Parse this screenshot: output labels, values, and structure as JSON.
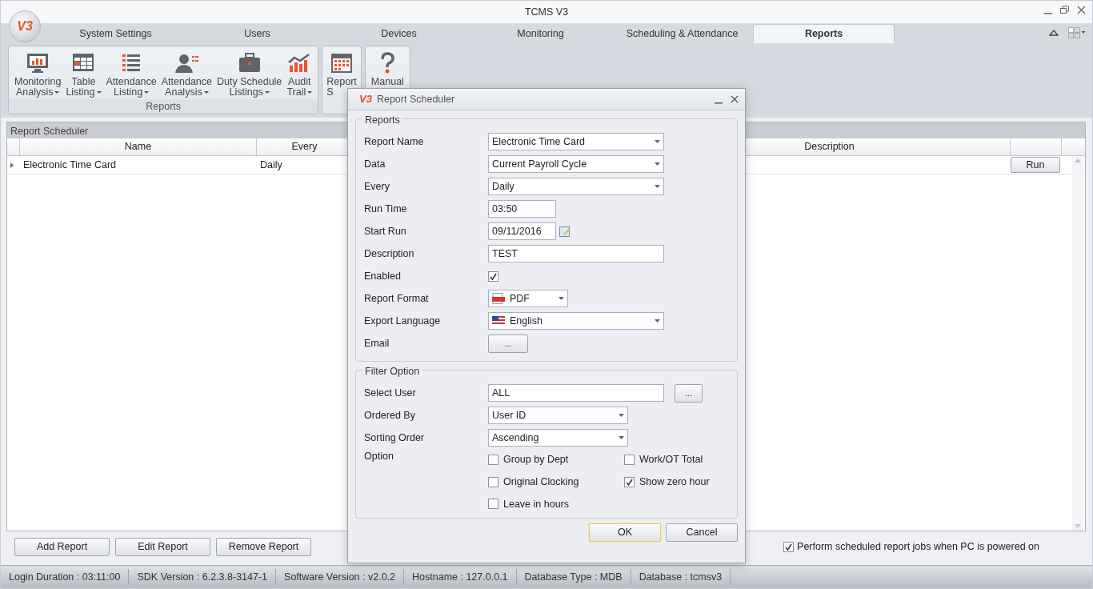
{
  "window": {
    "title": "TCMS V3",
    "logo": "V3"
  },
  "tabs": [
    {
      "label": "System Settings",
      "selected": false
    },
    {
      "label": "Users",
      "selected": false
    },
    {
      "label": "Devices",
      "selected": false
    },
    {
      "label": "Monitoring",
      "selected": false
    },
    {
      "label": "Scheduling & Attendance",
      "selected": false
    },
    {
      "label": "Reports",
      "selected": true
    }
  ],
  "ribbon": [
    {
      "label": "Reports",
      "buttons": [
        {
          "kind": "monitor",
          "lines": [
            "Monitoring",
            "Analysis"
          ],
          "dropdown": true
        },
        {
          "kind": "table",
          "lines": [
            "Table",
            "Listing"
          ],
          "dropdown": true
        },
        {
          "kind": "list",
          "lines": [
            "Attendance",
            "Listing"
          ],
          "dropdown": true
        },
        {
          "kind": "person",
          "lines": [
            "Attendance",
            "Analysis"
          ],
          "dropdown": true
        },
        {
          "kind": "briefcase",
          "lines": [
            "Duty Schedule",
            "Listings"
          ],
          "dropdown": true
        },
        {
          "kind": "trend",
          "lines": [
            "Audit",
            "Trail"
          ],
          "dropdown": true
        }
      ]
    },
    {
      "buttons": [
        {
          "kind": "calendar",
          "lines": [
            "Report",
            "S"
          ],
          "dropdown": false
        }
      ]
    },
    {
      "buttons": [
        {
          "kind": "help",
          "lines": [
            "Manual"
          ],
          "dropdown": false
        }
      ]
    }
  ],
  "panel": {
    "title": "Report Scheduler",
    "columns": [
      "Name",
      "Every",
      "Description"
    ],
    "rows": [
      {
        "name": "Electronic Time Card",
        "every": "Daily",
        "action": "Run"
      }
    ]
  },
  "buttons": [
    "Add Report",
    "Edit Report",
    "Remove Report"
  ],
  "auto_run": {
    "label": "Perform scheduled report jobs when PC is powered on",
    "checked": true
  },
  "status_bar": [
    "Login Duration : 03:11:00",
    "SDK Version : 6.2.3.8-3147-1",
    "Software Version : v2.0.2",
    "Hostname : 127.0.0.1",
    "Database Type : MDB",
    "Database : tcmsv3"
  ],
  "dialog": {
    "title": "Report Scheduler",
    "icon": "V3",
    "sections": [
      {
        "legend": "Reports",
        "fields": [
          {
            "label": "Report Name",
            "kind": "select",
            "value": "Electronic Time Card"
          },
          {
            "label": "Data",
            "kind": "select",
            "value": "Current Payroll Cycle"
          },
          {
            "label": "Every",
            "kind": "select",
            "value": "Daily"
          },
          {
            "label": "Run Time",
            "kind": "short-text",
            "value": "03:50"
          },
          {
            "label": "Start Run",
            "kind": "date",
            "value": "09/11/2016"
          },
          {
            "label": "Description",
            "kind": "text",
            "value": "TEST"
          },
          {
            "label": "Enabled",
            "kind": "checkbox",
            "checked": true
          },
          {
            "label": "Report Format",
            "kind": "format-select",
            "value": "PDF"
          },
          {
            "label": "Export Language",
            "kind": "language-select",
            "value": "English"
          },
          {
            "label": "Email",
            "kind": "more-button",
            "value": "..."
          }
        ]
      },
      {
        "legend": "Filter Option",
        "fields": [
          {
            "label": "Select User",
            "kind": "picker",
            "value": "ALL",
            "button": "..."
          },
          {
            "label": "Ordered By",
            "kind": "medium-select",
            "value": "User ID"
          },
          {
            "label": "Sorting Order",
            "kind": "medium-select",
            "value": "Ascending"
          },
          {
            "label": "Option",
            "kind": "options",
            "options": [
              {
                "label": "Group by Dept",
                "checked": false
              },
              {
                "label": "Work/OT Total",
                "checked": false
              },
              {
                "label": "Original Clocking",
                "checked": false
              },
              {
                "label": "Show zero hour",
                "checked": true
              },
              {
                "label": "Leave in hours",
                "checked": false
              }
            ]
          }
        ]
      }
    ],
    "buttons": [
      {
        "label": "OK",
        "focused": true
      },
      {
        "label": "Cancel",
        "focused": false
      }
    ]
  }
}
